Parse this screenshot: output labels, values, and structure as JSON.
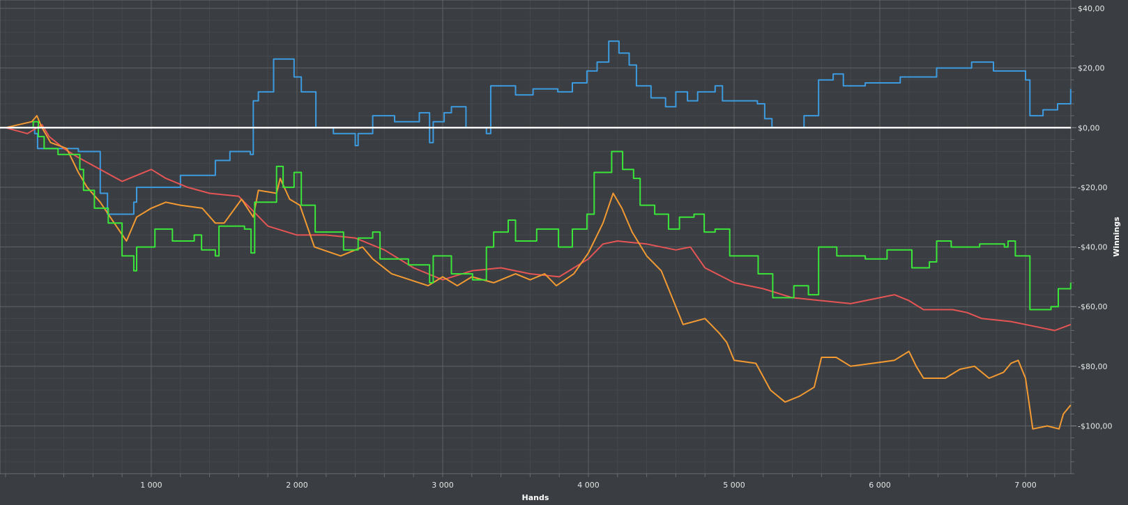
{
  "chart_data": {
    "type": "line",
    "title": "",
    "xlabel": "Hands",
    "ylabel": "Winnings",
    "xlim": [
      -38,
      7311
    ],
    "ylim": [
      -116,
      42.8
    ],
    "grid": true,
    "x_ticks": [
      {
        "value": 1000,
        "label": "1 000"
      },
      {
        "value": 2000,
        "label": "2 000"
      },
      {
        "value": 3000,
        "label": "3 000"
      },
      {
        "value": 4000,
        "label": "4 000"
      },
      {
        "value": 5000,
        "label": "5 000"
      },
      {
        "value": 6000,
        "label": "6 000"
      },
      {
        "value": 7000,
        "label": "7 000"
      }
    ],
    "y_ticks": [
      {
        "value": 40,
        "label": "$40,00"
      },
      {
        "value": 20,
        "label": "$20,00"
      },
      {
        "value": 0,
        "label": "$0,00"
      },
      {
        "value": -20,
        "label": "-$20,00"
      },
      {
        "value": -40,
        "label": "-$40,00"
      },
      {
        "value": -60,
        "label": "-$60,00"
      },
      {
        "value": -80,
        "label": "-$80,00"
      },
      {
        "value": -100,
        "label": "-$100,00"
      }
    ],
    "minor_x_step": 200,
    "minor_y_step": 4,
    "zero_line_color": "#ffffff",
    "series": [
      {
        "name": "blue",
        "color": "#3d9be0",
        "step": true,
        "points": [
          [
            0,
            0
          ],
          [
            200,
            -2
          ],
          [
            220,
            -7
          ],
          [
            500,
            -8
          ],
          [
            650,
            -22
          ],
          [
            700,
            -29
          ],
          [
            880,
            -25
          ],
          [
            900,
            -20
          ],
          [
            1200,
            -16
          ],
          [
            1440,
            -11
          ],
          [
            1540,
            -8
          ],
          [
            1680,
            -9
          ],
          [
            1700,
            9
          ],
          [
            1735,
            12
          ],
          [
            1840,
            23
          ],
          [
            1980,
            17
          ],
          [
            2030,
            12
          ],
          [
            2130,
            0
          ],
          [
            2250,
            -2
          ],
          [
            2400,
            -6
          ],
          [
            2420,
            -2
          ],
          [
            2520,
            4
          ],
          [
            2670,
            2
          ],
          [
            2840,
            5
          ],
          [
            2910,
            -5
          ],
          [
            2935,
            2
          ],
          [
            3010,
            5
          ],
          [
            3060,
            7
          ],
          [
            3160,
            0
          ],
          [
            3300,
            -2
          ],
          [
            3330,
            14
          ],
          [
            3500,
            11
          ],
          [
            3620,
            13
          ],
          [
            3790,
            12
          ],
          [
            3890,
            15
          ],
          [
            3990,
            19
          ],
          [
            4060,
            22
          ],
          [
            4140,
            29
          ],
          [
            4210,
            25
          ],
          [
            4280,
            21
          ],
          [
            4330,
            14
          ],
          [
            4430,
            10
          ],
          [
            4530,
            7
          ],
          [
            4600,
            12
          ],
          [
            4680,
            9
          ],
          [
            4750,
            12
          ],
          [
            4870,
            14
          ],
          [
            4920,
            9
          ],
          [
            5160,
            8
          ],
          [
            5210,
            3
          ],
          [
            5260,
            0
          ],
          [
            5430,
            0
          ],
          [
            5480,
            4
          ],
          [
            5580,
            16
          ],
          [
            5680,
            18
          ],
          [
            5750,
            14
          ],
          [
            5900,
            15
          ],
          [
            6140,
            17
          ],
          [
            6390,
            20
          ],
          [
            6630,
            22
          ],
          [
            6780,
            19
          ],
          [
            7000,
            16
          ],
          [
            7030,
            4
          ],
          [
            7120,
            6
          ],
          [
            7220,
            8
          ],
          [
            7310,
            13
          ]
        ]
      },
      {
        "name": "red",
        "color": "#e65555",
        "step": false,
        "points": [
          [
            0,
            0
          ],
          [
            150,
            -2
          ],
          [
            250,
            1
          ],
          [
            300,
            -3
          ],
          [
            400,
            -7
          ],
          [
            500,
            -10
          ],
          [
            650,
            -14
          ],
          [
            800,
            -18
          ],
          [
            900,
            -16
          ],
          [
            1000,
            -14
          ],
          [
            1100,
            -17
          ],
          [
            1250,
            -20
          ],
          [
            1400,
            -22
          ],
          [
            1600,
            -23
          ],
          [
            1700,
            -28
          ],
          [
            1800,
            -33
          ],
          [
            2000,
            -36
          ],
          [
            2200,
            -36
          ],
          [
            2400,
            -37
          ],
          [
            2600,
            -41
          ],
          [
            2800,
            -47
          ],
          [
            3000,
            -51
          ],
          [
            3200,
            -48
          ],
          [
            3400,
            -47
          ],
          [
            3600,
            -49
          ],
          [
            3800,
            -50
          ],
          [
            4000,
            -44
          ],
          [
            4100,
            -39
          ],
          [
            4200,
            -38
          ],
          [
            4400,
            -39
          ],
          [
            4600,
            -41
          ],
          [
            4700,
            -40
          ],
          [
            4800,
            -47
          ],
          [
            5000,
            -52
          ],
          [
            5200,
            -54
          ],
          [
            5400,
            -57
          ],
          [
            5600,
            -58
          ],
          [
            5800,
            -59
          ],
          [
            6000,
            -57
          ],
          [
            6100,
            -56
          ],
          [
            6200,
            -58
          ],
          [
            6300,
            -61
          ],
          [
            6500,
            -61
          ],
          [
            6600,
            -62
          ],
          [
            6700,
            -64
          ],
          [
            6900,
            -65
          ],
          [
            7100,
            -67
          ],
          [
            7200,
            -68
          ],
          [
            7310,
            -66
          ]
        ]
      },
      {
        "name": "orange",
        "color": "#f39a32",
        "step": false,
        "points": [
          [
            0,
            0
          ],
          [
            180,
            2
          ],
          [
            215,
            4
          ],
          [
            250,
            0
          ],
          [
            310,
            -5
          ],
          [
            420,
            -7
          ],
          [
            500,
            -15
          ],
          [
            560,
            -20
          ],
          [
            650,
            -25
          ],
          [
            760,
            -33
          ],
          [
            830,
            -38
          ],
          [
            900,
            -30
          ],
          [
            1000,
            -27
          ],
          [
            1100,
            -25
          ],
          [
            1200,
            -26
          ],
          [
            1350,
            -27
          ],
          [
            1440,
            -32
          ],
          [
            1500,
            -32
          ],
          [
            1620,
            -24
          ],
          [
            1700,
            -30
          ],
          [
            1735,
            -21
          ],
          [
            1860,
            -22
          ],
          [
            1885,
            -17
          ],
          [
            1950,
            -24
          ],
          [
            2020,
            -26
          ],
          [
            2120,
            -40
          ],
          [
            2300,
            -43
          ],
          [
            2450,
            -40
          ],
          [
            2520,
            -44
          ],
          [
            2650,
            -49
          ],
          [
            2900,
            -53
          ],
          [
            3000,
            -50
          ],
          [
            3100,
            -53
          ],
          [
            3200,
            -50
          ],
          [
            3350,
            -52
          ],
          [
            3500,
            -49
          ],
          [
            3600,
            -51
          ],
          [
            3700,
            -49
          ],
          [
            3780,
            -53
          ],
          [
            3900,
            -49
          ],
          [
            4000,
            -42
          ],
          [
            4100,
            -32
          ],
          [
            4170,
            -22
          ],
          [
            4230,
            -27
          ],
          [
            4300,
            -35
          ],
          [
            4400,
            -43
          ],
          [
            4500,
            -48
          ],
          [
            4600,
            -60
          ],
          [
            4650,
            -66
          ],
          [
            4800,
            -64
          ],
          [
            4900,
            -69
          ],
          [
            4950,
            -72
          ],
          [
            5000,
            -78
          ],
          [
            5150,
            -79
          ],
          [
            5250,
            -88
          ],
          [
            5350,
            -92
          ],
          [
            5450,
            -90
          ],
          [
            5550,
            -87
          ],
          [
            5600,
            -77
          ],
          [
            5700,
            -77
          ],
          [
            5800,
            -80
          ],
          [
            5950,
            -79
          ],
          [
            6100,
            -78
          ],
          [
            6200,
            -75
          ],
          [
            6250,
            -80
          ],
          [
            6300,
            -84
          ],
          [
            6450,
            -84
          ],
          [
            6550,
            -81
          ],
          [
            6650,
            -80
          ],
          [
            6750,
            -84
          ],
          [
            6850,
            -82
          ],
          [
            6900,
            -79
          ],
          [
            6950,
            -78
          ],
          [
            7000,
            -84
          ],
          [
            7050,
            -101
          ],
          [
            7150,
            -100
          ],
          [
            7230,
            -101
          ],
          [
            7260,
            -96
          ],
          [
            7310,
            -93
          ]
        ]
      },
      {
        "name": "green",
        "color": "#3ae63a",
        "step": true,
        "points": [
          [
            0,
            0
          ],
          [
            190,
            2
          ],
          [
            225,
            -3
          ],
          [
            265,
            -7
          ],
          [
            360,
            -9
          ],
          [
            510,
            -14
          ],
          [
            535,
            -21
          ],
          [
            610,
            -27
          ],
          [
            705,
            -32
          ],
          [
            800,
            -43
          ],
          [
            880,
            -48
          ],
          [
            900,
            -40
          ],
          [
            1025,
            -34
          ],
          [
            1145,
            -38
          ],
          [
            1295,
            -36
          ],
          [
            1345,
            -41
          ],
          [
            1440,
            -43
          ],
          [
            1465,
            -33
          ],
          [
            1640,
            -34
          ],
          [
            1685,
            -42
          ],
          [
            1710,
            -25
          ],
          [
            1860,
            -13
          ],
          [
            1905,
            -20
          ],
          [
            1980,
            -15
          ],
          [
            2030,
            -26
          ],
          [
            2125,
            -35
          ],
          [
            2320,
            -41
          ],
          [
            2420,
            -37
          ],
          [
            2520,
            -35
          ],
          [
            2570,
            -44
          ],
          [
            2765,
            -46
          ],
          [
            2910,
            -52
          ],
          [
            2935,
            -43
          ],
          [
            3060,
            -49
          ],
          [
            3205,
            -51
          ],
          [
            3300,
            -40
          ],
          [
            3350,
            -35
          ],
          [
            3450,
            -31
          ],
          [
            3500,
            -38
          ],
          [
            3645,
            -34
          ],
          [
            3795,
            -40
          ],
          [
            3890,
            -34
          ],
          [
            3990,
            -29
          ],
          [
            4040,
            -15
          ],
          [
            4160,
            -8
          ],
          [
            4235,
            -14
          ],
          [
            4310,
            -17
          ],
          [
            4355,
            -26
          ],
          [
            4455,
            -29
          ],
          [
            4550,
            -34
          ],
          [
            4625,
            -30
          ],
          [
            4725,
            -29
          ],
          [
            4795,
            -35
          ],
          [
            4870,
            -34
          ],
          [
            4970,
            -43
          ],
          [
            5165,
            -49
          ],
          [
            5265,
            -57
          ],
          [
            5410,
            -53
          ],
          [
            5510,
            -56
          ],
          [
            5580,
            -40
          ],
          [
            5705,
            -43
          ],
          [
            5900,
            -44
          ],
          [
            6050,
            -41
          ],
          [
            6220,
            -47
          ],
          [
            6340,
            -45
          ],
          [
            6390,
            -38
          ],
          [
            6490,
            -40
          ],
          [
            6685,
            -39
          ],
          [
            6855,
            -40
          ],
          [
            6880,
            -38
          ],
          [
            6930,
            -43
          ],
          [
            7030,
            -61
          ],
          [
            7175,
            -60
          ],
          [
            7225,
            -54
          ],
          [
            7310,
            -52
          ]
        ]
      }
    ]
  }
}
